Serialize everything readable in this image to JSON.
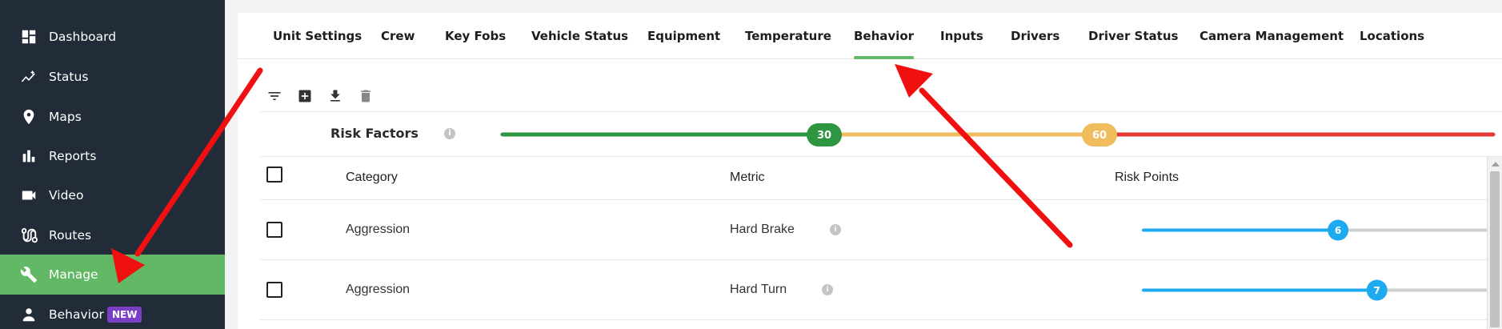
{
  "sidebar": {
    "items": [
      {
        "label": "Dashboard",
        "icon": "dashboard-icon"
      },
      {
        "label": "Status",
        "icon": "status-icon"
      },
      {
        "label": "Maps",
        "icon": "map-pin-icon"
      },
      {
        "label": "Reports",
        "icon": "bar-chart-icon"
      },
      {
        "label": "Video",
        "icon": "video-camera-icon"
      },
      {
        "label": "Routes",
        "icon": "route-icon"
      },
      {
        "label": "Manage",
        "icon": "wrench-icon",
        "active": true
      },
      {
        "label": "Behavior",
        "icon": "person-icon",
        "badge": "NEW"
      }
    ]
  },
  "tabs": [
    {
      "label": "Unit Settings"
    },
    {
      "label": "Crew"
    },
    {
      "label": "Key Fobs"
    },
    {
      "label": "Vehicle Status"
    },
    {
      "label": "Equipment"
    },
    {
      "label": "Temperature"
    },
    {
      "label": "Behavior",
      "active": true
    },
    {
      "label": "Inputs"
    },
    {
      "label": "Drivers"
    },
    {
      "label": "Driver Status"
    },
    {
      "label": "Camera Management"
    },
    {
      "label": "Locations"
    }
  ],
  "toolbar": {
    "icons": [
      "filter-icon",
      "add-box-icon",
      "download-icon",
      "delete-icon"
    ]
  },
  "risk_factors": {
    "title": "Risk Factors",
    "info": "i",
    "low_threshold": "30",
    "high_threshold": "60",
    "colors": {
      "low": "#2e9640",
      "mid": "#f0bd5e",
      "high": "#e53935"
    }
  },
  "table": {
    "headers": {
      "category": "Category",
      "metric": "Metric",
      "risk_points": "Risk Points"
    },
    "rows": [
      {
        "category": "Aggression",
        "metric": "Hard Brake",
        "info": "i",
        "risk_points": "6",
        "fraction": 0.55
      },
      {
        "category": "Aggression",
        "metric": "Hard Turn",
        "info": "i",
        "risk_points": "7",
        "fraction": 0.66
      }
    ]
  },
  "colors": {
    "sidebar_bg": "#222b38",
    "active_green": "#62b865",
    "badge_purple": "#7b3fc6",
    "slider_blue": "#1eaaf1",
    "annotation_red": "#f01010"
  }
}
